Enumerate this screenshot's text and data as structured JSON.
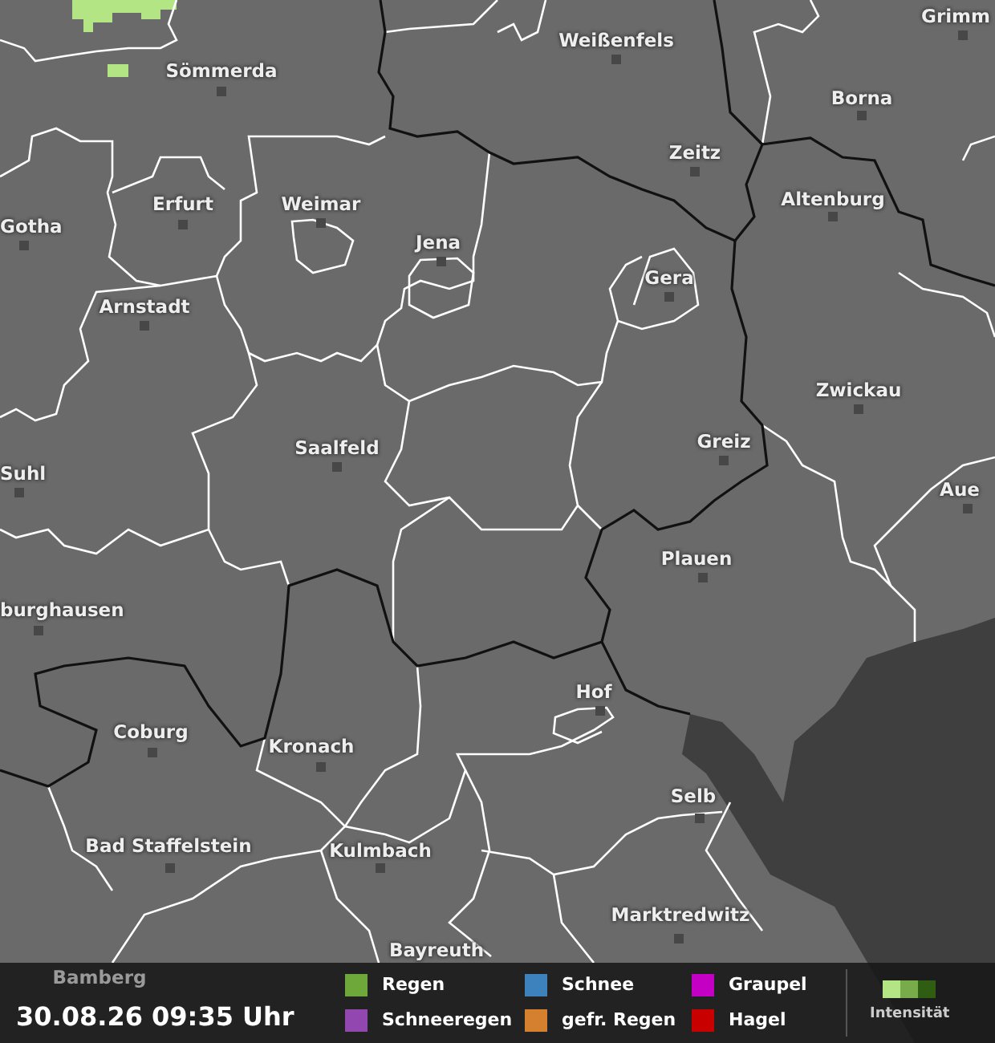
{
  "map": {
    "cities": [
      {
        "name": "Sömmerda"
      },
      {
        "name": "Weißenfels"
      },
      {
        "name": "Grimm"
      },
      {
        "name": "Borna"
      },
      {
        "name": "Zeitz"
      },
      {
        "name": "Erfurt"
      },
      {
        "name": "Weimar"
      },
      {
        "name": "Altenburg"
      },
      {
        "name": "Gotha"
      },
      {
        "name": "Jena"
      },
      {
        "name": "Gera"
      },
      {
        "name": "Arnstadt"
      },
      {
        "name": "Zwickau"
      },
      {
        "name": "Greiz"
      },
      {
        "name": "Saalfeld"
      },
      {
        "name": "Suhl"
      },
      {
        "name": "Aue"
      },
      {
        "name": "Plauen"
      },
      {
        "name": "burghausen"
      },
      {
        "name": "Hof"
      },
      {
        "name": "Coburg"
      },
      {
        "name": "Kronach"
      },
      {
        "name": "Selb"
      },
      {
        "name": "Bad Staffelstein"
      },
      {
        "name": "Kulmbach"
      },
      {
        "name": "Marktredwitz"
      },
      {
        "name": "Bayreuth"
      },
      {
        "name": "Bamberg"
      }
    ]
  },
  "footer": {
    "timestamp": "30.08.26 09:35 Uhr",
    "legend": [
      {
        "label": "Regen",
        "color": "#6fa83a"
      },
      {
        "label": "Schneeregen",
        "color": "#9146b0"
      },
      {
        "label": "Schnee",
        "color": "#3d82bd"
      },
      {
        "label": "gefr. Regen",
        "color": "#d5802e"
      },
      {
        "label": "Graupel",
        "color": "#c400c4"
      },
      {
        "label": "Hagel",
        "color": "#c80000"
      }
    ],
    "intensity": {
      "label": "Intensität",
      "levels": [
        {
          "color": "#b3e585"
        },
        {
          "color": "#78ab49"
        },
        {
          "color": "#2f5e12"
        }
      ]
    }
  }
}
